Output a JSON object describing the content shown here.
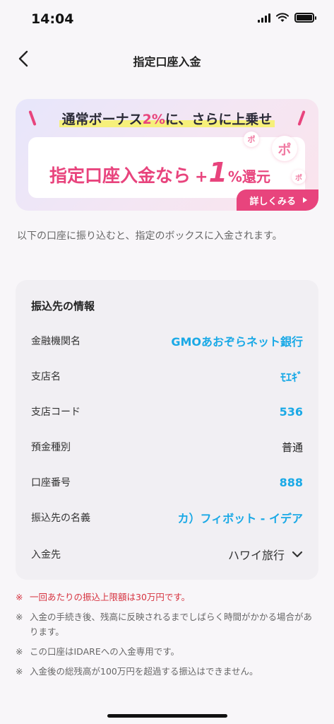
{
  "status_bar": {
    "time": "14:04"
  },
  "header": {
    "title": "指定口座入金"
  },
  "banner": {
    "headline_prefix": "通常ボーナス",
    "headline_pct": "2%",
    "headline_suffix": "に、さらに上乗せ",
    "main_text": "指定口座入金なら",
    "plus": "+",
    "big_number": "1",
    "percent": "%",
    "reward": "還元",
    "po_char": "ポ",
    "detail_button": "詳しくみる",
    "accent_color": "#e8447d"
  },
  "description": "以下の口座に振り込むと、指定のボックスに入金されます。",
  "info": {
    "title": "振込先の情報",
    "rows": [
      {
        "label": "金融機関名",
        "value": "GMOあおぞらネット銀行"
      },
      {
        "label": "支店名",
        "value": "ﾓｴｷﾞ"
      },
      {
        "label": "支店コード",
        "value": "536"
      },
      {
        "label": "預金種別",
        "value": "普通"
      },
      {
        "label": "口座番号",
        "value": "888"
      },
      {
        "label": "振込先の名義",
        "value": "カ）フィボット - イデア"
      },
      {
        "label": "入金先",
        "value": "ハワイ旅行"
      }
    ],
    "value_color": "#1aa9e6"
  },
  "notes": [
    {
      "mark": "※",
      "text": "一回あたりの振込上限額は30万円です。"
    },
    {
      "mark": "※",
      "text": "入金の手続き後、残高に反映されるまでしばらく時間がかかる場合があります。"
    },
    {
      "mark": "※",
      "text": "この口座はIDAREへの入金専用です。"
    },
    {
      "mark": "※",
      "text": "入金後の総残高が100万円を超過する振込はできません。"
    }
  ]
}
